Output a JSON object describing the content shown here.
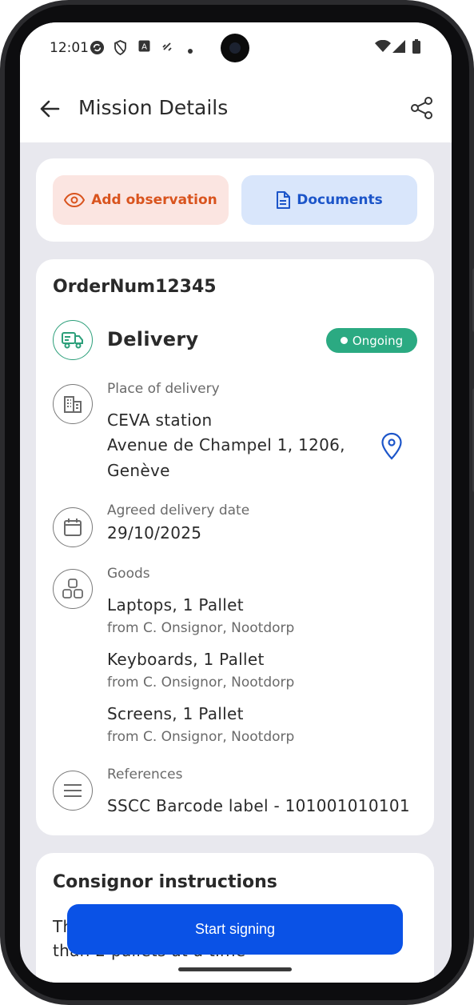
{
  "status_bar": {
    "time": "12:01",
    "icons": [
      "sync-icon",
      "shield-icon",
      "a-icon",
      "link-icon",
      "dot-icon"
    ],
    "right_icons": [
      "wifi-icon",
      "signal-icon",
      "battery-icon"
    ]
  },
  "app_bar": {
    "title": "Mission Details",
    "back_icon": "arrow-back-icon",
    "share_icon": "share-icon"
  },
  "actions": {
    "observation_label": "Add observation",
    "documents_label": "Documents"
  },
  "mission": {
    "order_number": "OrderNum12345",
    "type": "Delivery",
    "status": "Ongoing",
    "place": {
      "label": "Place of delivery",
      "name": "CEVA station",
      "address_line1": "Avenue de Champel 1, 1206,",
      "address_line2": "Genève"
    },
    "date": {
      "label": "Agreed delivery date",
      "value": "29/10/2025"
    },
    "goods": {
      "label": "Goods",
      "items": [
        {
          "name": "Laptops, 1 Pallet",
          "from": "from C. Onsignor, Nootdorp"
        },
        {
          "name": "Keyboards, 1 Pallet",
          "from": "from C. Onsignor, Nootdorp"
        },
        {
          "name": "Screens, 1 Pallet",
          "from": "from C. Onsignor, Nootdorp"
        }
      ]
    },
    "references": {
      "label": "References",
      "value": "SSCC Barcode label - 101001010101"
    }
  },
  "instructions": {
    "title": "Consignor instructions",
    "text_partial_top": "Th",
    "text_partial_bottom": "than 2 pallets at a time"
  },
  "cta": {
    "start_signing": "Start signing"
  },
  "colors": {
    "accent_blue": "#0a52e6",
    "status_green": "#2baa82",
    "observation_orange": "#d9541e"
  }
}
